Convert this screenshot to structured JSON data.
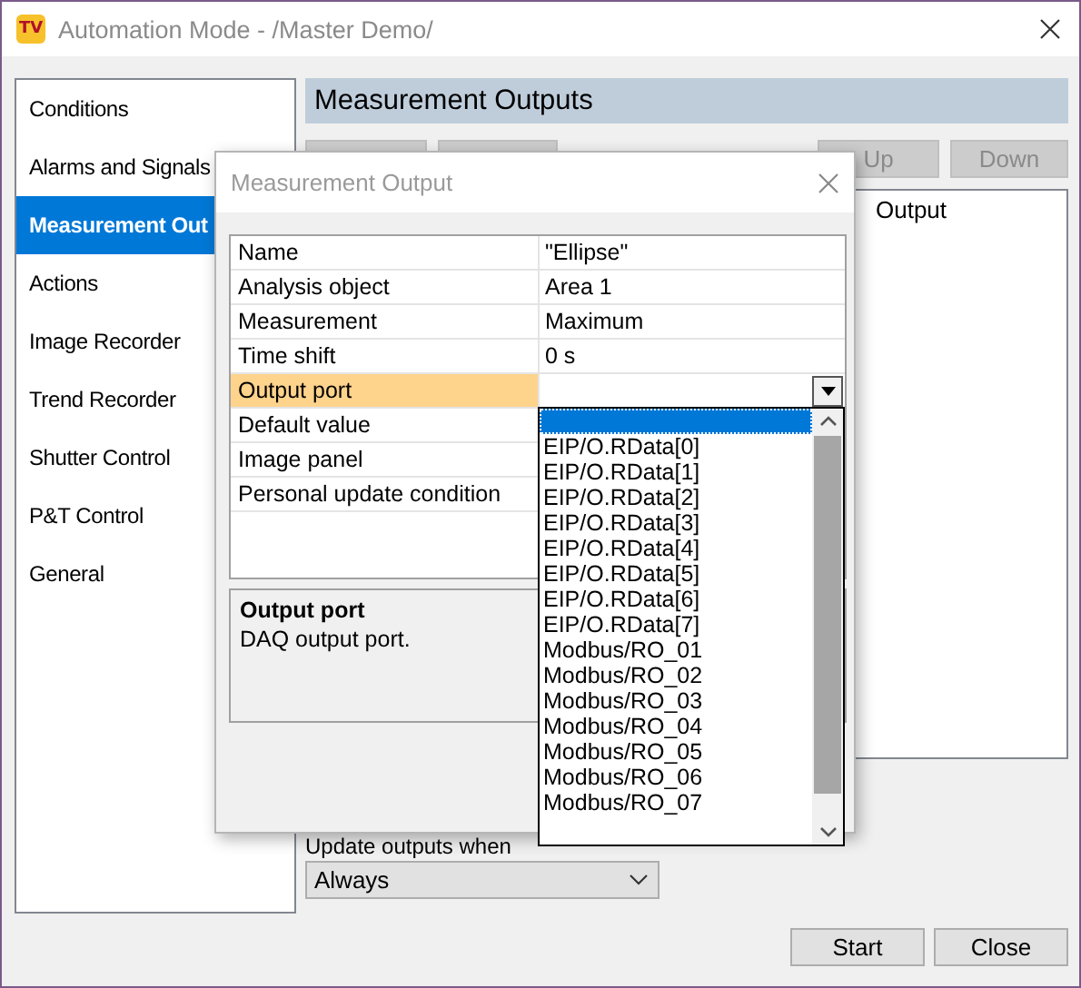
{
  "window": {
    "logo": "TV",
    "title": "Automation Mode - /Master Demo/"
  },
  "sidebar": {
    "items": [
      {
        "label": "Conditions",
        "selected": false
      },
      {
        "label": "Alarms and Signals",
        "selected": false
      },
      {
        "label": "Measurement Out",
        "selected": true
      },
      {
        "label": "Actions",
        "selected": false
      },
      {
        "label": "Image Recorder",
        "selected": false
      },
      {
        "label": "Trend Recorder",
        "selected": false
      },
      {
        "label": "Shutter Control",
        "selected": false
      },
      {
        "label": "P&T Control",
        "selected": false
      },
      {
        "label": "General",
        "selected": false
      }
    ]
  },
  "panel": {
    "title": "Measurement Outputs",
    "left_buttons": [
      {
        "disabled": true
      },
      {
        "disabled": true
      }
    ],
    "right_buttons": [
      {
        "label": "Up",
        "disabled": true
      },
      {
        "label": "Down",
        "disabled": true
      }
    ],
    "list": {
      "columns": [
        "Output"
      ]
    },
    "update_label": "Update outputs when",
    "update_select": {
      "value": "Always"
    }
  },
  "footer_buttons": [
    "Start",
    "Close"
  ],
  "dialog": {
    "title": "Measurement Output",
    "properties": [
      {
        "name": "Name",
        "value": "\"Ellipse\"",
        "selected": false
      },
      {
        "name": "Analysis object",
        "value": "Area 1",
        "selected": false
      },
      {
        "name": "Measurement",
        "value": "Maximum",
        "selected": false
      },
      {
        "name": "Time shift",
        "value": "0 s",
        "selected": false
      },
      {
        "name": "Output port",
        "selected": true
      },
      {
        "name": "Default value",
        "selected": false
      },
      {
        "name": "Image panel",
        "selected": false
      },
      {
        "name": "Personal update condition",
        "selected": false
      }
    ],
    "description": {
      "title": "Output port",
      "text": "DAQ output port."
    },
    "dropdown": {
      "items": [
        {
          "selected": true
        },
        {
          "label": "EIP/O.RData[0]",
          "selected": false
        },
        {
          "label": "EIP/O.RData[1]",
          "selected": false
        },
        {
          "label": "EIP/O.RData[2]",
          "selected": false
        },
        {
          "label": "EIP/O.RData[3]",
          "selected": false
        },
        {
          "label": "EIP/O.RData[4]",
          "selected": false
        },
        {
          "label": "EIP/O.RData[5]",
          "selected": false
        },
        {
          "label": "EIP/O.RData[6]",
          "selected": false
        },
        {
          "label": "EIP/O.RData[7]",
          "selected": false
        },
        {
          "label": "Modbus/RO_01",
          "selected": false
        },
        {
          "label": "Modbus/RO_02",
          "selected": false
        },
        {
          "label": "Modbus/RO_03",
          "selected": false
        },
        {
          "label": "Modbus/RO_04",
          "selected": false
        },
        {
          "label": "Modbus/RO_05",
          "selected": false
        },
        {
          "label": "Modbus/RO_06",
          "selected": false
        },
        {
          "label": "Modbus/RO_07",
          "selected": false
        }
      ]
    }
  }
}
